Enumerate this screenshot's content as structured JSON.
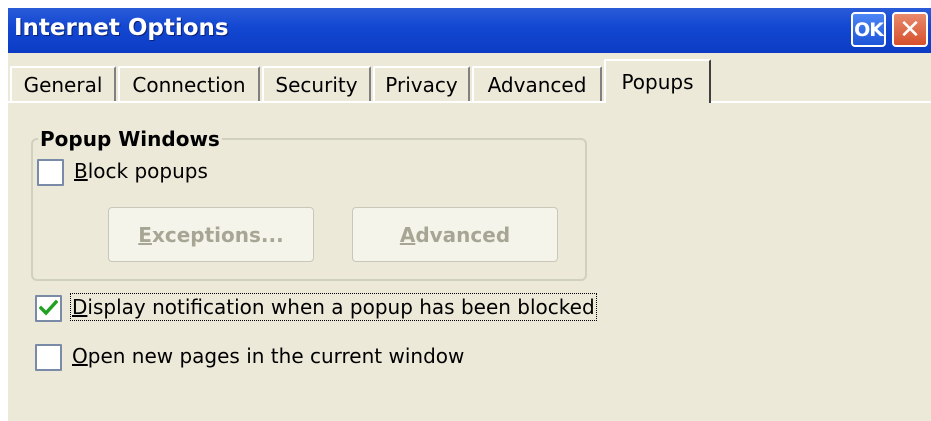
{
  "window": {
    "title": "Internet Options",
    "ok_label": "OK",
    "close_label": "✕"
  },
  "tabs": [
    {
      "label": "General"
    },
    {
      "label": "Connection"
    },
    {
      "label": "Security"
    },
    {
      "label": "Privacy"
    },
    {
      "label": "Advanced"
    },
    {
      "label": "Popups",
      "active": true
    }
  ],
  "popup_windows": {
    "group_label": "Popup Windows",
    "block_popups": {
      "mnemonic": "B",
      "rest": "lock popups",
      "checked": false
    },
    "exceptions_button": {
      "mnemonic": "E",
      "rest": "xceptions...",
      "enabled": false
    },
    "advanced_button": {
      "mnemonic": "A",
      "rest": "dvanced",
      "enabled": false
    }
  },
  "display_notification": {
    "mnemonic": "D",
    "rest": "isplay notification when a popup has been blocked",
    "checked": true
  },
  "open_new_pages": {
    "mnemonic": "O",
    "rest": "pen new pages in the current window",
    "checked": false
  },
  "colors": {
    "title_bar": "#0c3cc4",
    "dialog_background": "#ece9d8",
    "checkmark": "#21a121",
    "disabled_text": "#a7a695"
  }
}
